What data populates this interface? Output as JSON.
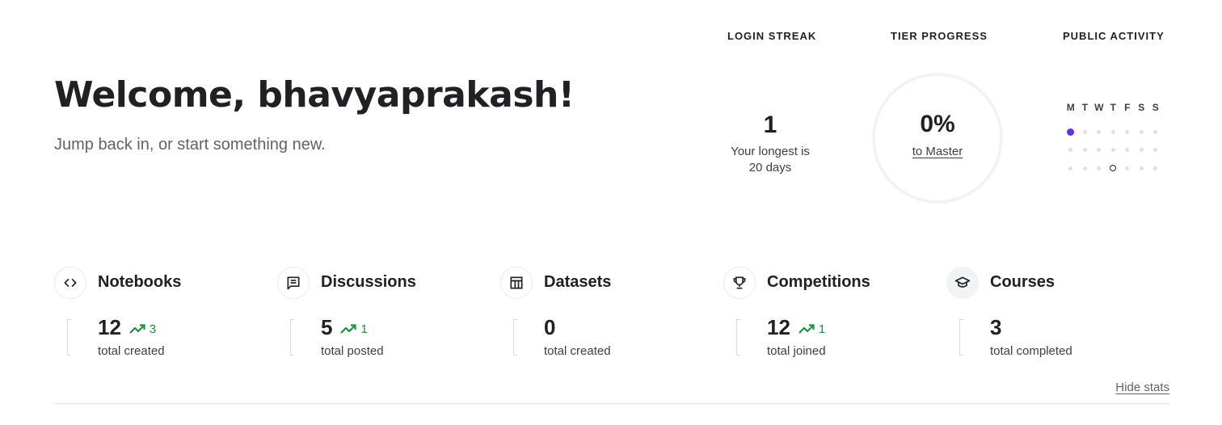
{
  "welcome": {
    "title": "Welcome, bhavyaprakash!",
    "subtitle": "Jump back in, or start something new."
  },
  "login_streak": {
    "heading": "LOGIN STREAK",
    "value": "1",
    "longest_line1": "Your longest is",
    "longest_line2": "20 days"
  },
  "tier_progress": {
    "heading": "TIER PROGRESS",
    "percent": "0%",
    "link_label": "to Master",
    "progress_fraction": 0
  },
  "public_activity": {
    "heading": "PUBLIC ACTIVITY",
    "day_letters": [
      "M",
      "T",
      "W",
      "T",
      "F",
      "S",
      "S"
    ],
    "weeks": [
      [
        "active",
        "empty",
        "empty",
        "empty",
        "empty",
        "empty",
        "empty"
      ],
      [
        "empty",
        "empty",
        "empty",
        "empty",
        "empty",
        "empty",
        "empty"
      ],
      [
        "empty",
        "empty",
        "empty",
        "today",
        "empty",
        "empty",
        "empty"
      ]
    ],
    "active_color": "#6330e6"
  },
  "stats": [
    {
      "key": "notebooks",
      "icon": "code-icon",
      "title": "Notebooks",
      "value": "12",
      "trend": "3",
      "label": "total created"
    },
    {
      "key": "discussions",
      "icon": "comment-icon",
      "title": "Discussions",
      "value": "5",
      "trend": "1",
      "label": "total posted"
    },
    {
      "key": "datasets",
      "icon": "table-icon",
      "title": "Datasets",
      "value": "0",
      "trend": "",
      "label": "total created"
    },
    {
      "key": "competitions",
      "icon": "trophy-icon",
      "title": "Competitions",
      "value": "12",
      "trend": "1",
      "label": "total joined"
    },
    {
      "key": "courses",
      "icon": "school-icon",
      "title": "Courses",
      "value": "3",
      "trend": "",
      "label": "total completed"
    }
  ],
  "trend_color": "#1e8e3e",
  "hide_stats_label": "Hide stats"
}
